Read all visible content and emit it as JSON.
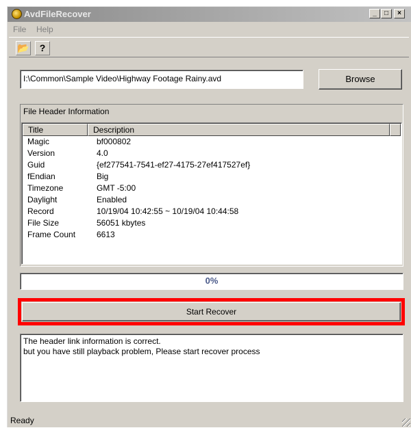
{
  "window": {
    "title": "AvdFileRecover",
    "min_glyph": "_",
    "max_glyph": "□",
    "close_glyph": "×"
  },
  "menu": {
    "file": "File",
    "help": "Help"
  },
  "toolbar": {
    "open_icon": "📂",
    "help_icon": "?"
  },
  "file_path": "I:\\Common\\Sample Video\\Highway Footage Rainy.avd",
  "browse_label": "Browse",
  "header_group": {
    "title": "File Header Information",
    "columns": [
      "Title",
      "Description"
    ],
    "rows": [
      {
        "title": "Magic",
        "description": "bf000802"
      },
      {
        "title": "Version",
        "description": "4.0"
      },
      {
        "title": "Guid",
        "description": "{ef277541-7541-ef27-4175-27ef417527ef}"
      },
      {
        "title": "fEndian",
        "description": "Big"
      },
      {
        "title": "Timezone",
        "description": "GMT -5:00"
      },
      {
        "title": "Daylight",
        "description": "Enabled"
      },
      {
        "title": "Record",
        "description": "10/19/04 10:42:55 ~ 10/19/04 10:44:58"
      },
      {
        "title": "File Size",
        "description": "56051 kbytes"
      },
      {
        "title": "Frame Count",
        "description": "6613"
      }
    ]
  },
  "progress": {
    "text": "0%",
    "value": 0
  },
  "start_label": "Start Recover",
  "log": {
    "line1": "The header link information is correct.",
    "line2": "but you have still playback problem, Please start recover process"
  },
  "status": "Ready",
  "colors": {
    "highlight": "#ff0000",
    "face": "#d4d0c8"
  }
}
